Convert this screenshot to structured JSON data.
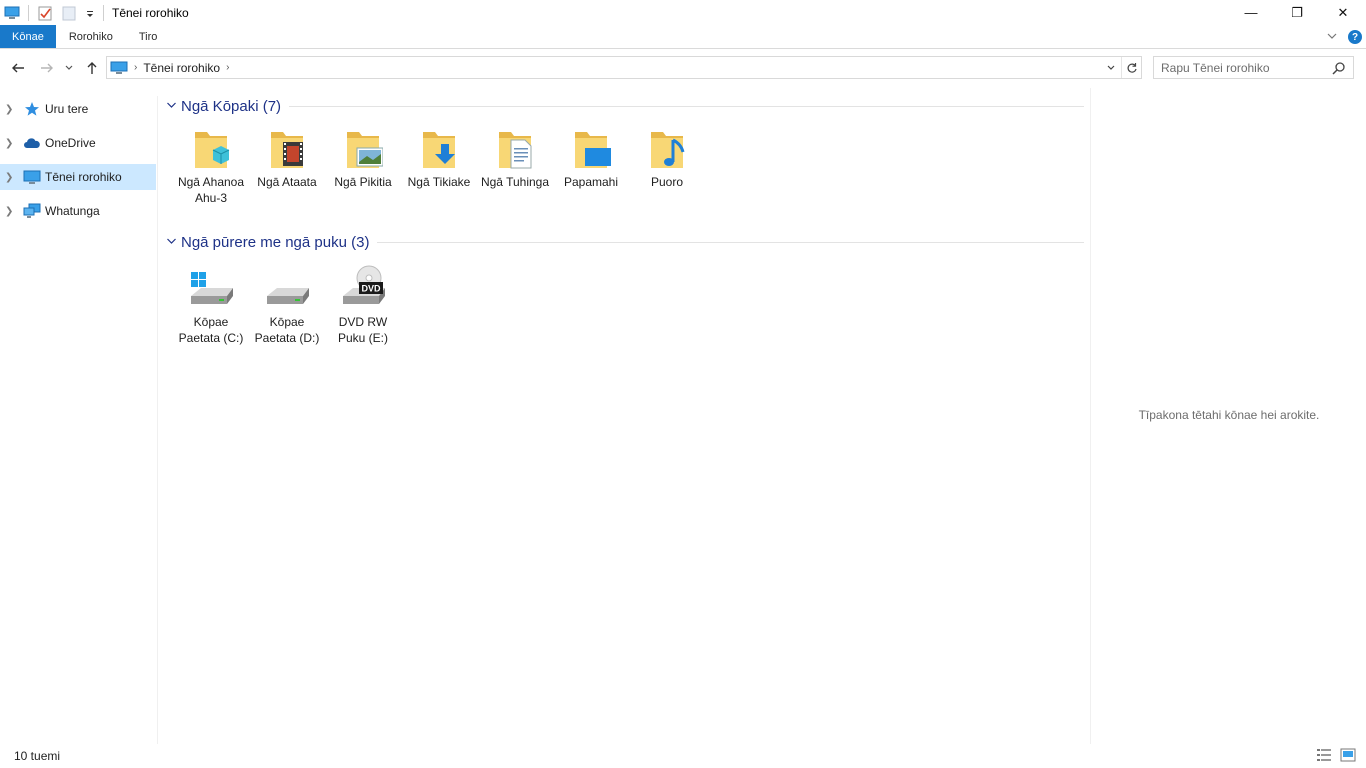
{
  "window": {
    "title": "Tēnei rorohiko",
    "minimize_glyph": "—",
    "maximize_glyph": "❐",
    "close_glyph": "✕"
  },
  "ribbon": {
    "tabs": [
      {
        "label": "Kōnae",
        "active": true
      },
      {
        "label": "Rorohiko",
        "active": false
      },
      {
        "label": "Tiro",
        "active": false
      }
    ],
    "help_glyph": "?"
  },
  "address": {
    "breadcrumb": "Tēnei rorohiko"
  },
  "search": {
    "placeholder": "Rapu Tēnei rorohiko"
  },
  "nav": {
    "items": [
      {
        "label": "Uru tere",
        "icon": "quick-access-star-icon",
        "selected": false
      },
      {
        "label": "OneDrive",
        "icon": "onedrive-cloud-icon",
        "selected": false
      },
      {
        "label": "Tēnei rorohiko",
        "icon": "this-pc-icon",
        "selected": true
      },
      {
        "label": "Whatunga",
        "icon": "network-icon",
        "selected": false
      }
    ]
  },
  "groups": {
    "folders": {
      "title": "Ngā Kōpaki (7)",
      "items": [
        {
          "label": "Ngā Ahanoa Ahu-3",
          "icon": "3d-objects-folder-icon"
        },
        {
          "label": "Ngā Ataata",
          "icon": "videos-folder-icon"
        },
        {
          "label": "Ngā Pikitia",
          "icon": "pictures-folder-icon"
        },
        {
          "label": "Ngā Tikiake",
          "icon": "downloads-folder-icon"
        },
        {
          "label": "Ngā Tuhinga",
          "icon": "documents-folder-icon"
        },
        {
          "label": "Papamahi",
          "icon": "desktop-folder-icon"
        },
        {
          "label": "Puoro",
          "icon": "music-folder-icon"
        }
      ]
    },
    "drives": {
      "title": "Ngā pūrere me ngā puku (3)",
      "items": [
        {
          "label": "Kōpae Paetata (C:)",
          "icon": "windows-drive-icon"
        },
        {
          "label": "Kōpae Paetata (D:)",
          "icon": "local-drive-icon"
        },
        {
          "label": "DVD RW Puku (E:)",
          "icon": "dvd-drive-icon",
          "badge": "DVD"
        }
      ]
    }
  },
  "preview": {
    "message": "Tīpakona tētahi kōnae hei arokite."
  },
  "status": {
    "item_count": "10 tuemi"
  },
  "colors": {
    "accent": "#1979ca",
    "selection": "#cce8ff",
    "group_header": "#1e3287",
    "folder": "#f8d775"
  }
}
